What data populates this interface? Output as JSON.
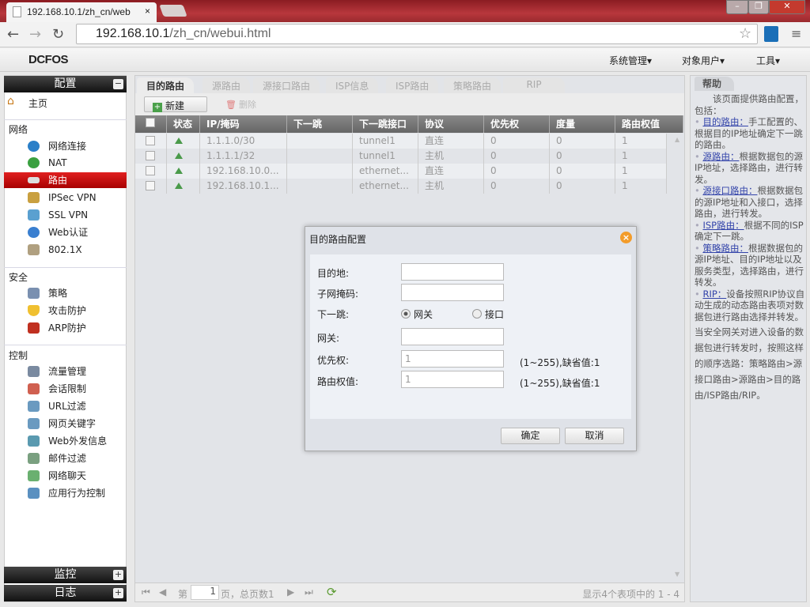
{
  "browser": {
    "tab_title": "192.168.10.1/zh_cn/web",
    "tab_close": "×",
    "url_host": "192.168.10.1",
    "url_path": "/zh_cn/webui.html"
  },
  "app": {
    "logo": "DCFOS",
    "menus": [
      "系统管理▾",
      "对象用户▾",
      "工具▾"
    ]
  },
  "sidebar": {
    "config_header": "配置",
    "home": "主页",
    "groups": [
      {
        "label": "网络",
        "items": [
          "网络连接",
          "NAT",
          "路由",
          "IPSec VPN",
          "SSL VPN",
          "Web认证",
          "802.1X"
        ]
      },
      {
        "label": "安全",
        "items": [
          "策略",
          "攻击防护",
          "ARP防护"
        ]
      },
      {
        "label": "控制",
        "items": [
          "流量管理",
          "会话限制",
          "URL过滤",
          "网页关键字",
          "Web外发信息",
          "邮件过滤",
          "网络聊天",
          "应用行为控制"
        ]
      }
    ],
    "monitor_header": "监控",
    "log_header": "日志",
    "selected": "路由"
  },
  "tabs": [
    "目的路由",
    "源路由",
    "源接口路由",
    "ISP信息",
    "ISP路由",
    "策略路由",
    "RIP"
  ],
  "toolbar": {
    "new": "新建",
    "delete": "删除"
  },
  "table": {
    "headers": [
      "状态",
      "IP/掩码",
      "下一跳",
      "下一跳接口",
      "协议",
      "优先权",
      "度量",
      "路由权值"
    ],
    "rows": [
      [
        "1.1.1.0/30",
        "",
        "tunnel1",
        "直连",
        "0",
        "0",
        "1"
      ],
      [
        "1.1.1.1/32",
        "",
        "tunnel1",
        "主机",
        "0",
        "0",
        "1"
      ],
      [
        "192.168.10.0...",
        "",
        "ethernet...",
        "直连",
        "0",
        "0",
        "1"
      ],
      [
        "192.168.10.1...",
        "",
        "ethernet...",
        "主机",
        "0",
        "0",
        "1"
      ]
    ]
  },
  "pager": {
    "page_prefix": "第",
    "page": "1",
    "page_suffix": "页，总页数1",
    "summary": "显示4个表项中的 1 - 4"
  },
  "help": {
    "title": "帮助",
    "intro": "该页面提供路由配置，包括：",
    "items": [
      {
        "link": "目的路由：",
        "text": "手工配置的、根据目的IP地址确定下一跳的路由。"
      },
      {
        "link": "源路由：",
        "text": "根据数据包的源IP地址，选择路由，进行转发。"
      },
      {
        "link": "源接口路由：",
        "text": "根据数据包的源IP地址和入接口，选择路由，进行转发。"
      },
      {
        "link": "ISP路由：",
        "text": "根据不同的ISP确定下一跳。"
      },
      {
        "link": "策略路由：",
        "text": "根据数据包的源IP地址、目的IP地址以及服务类型，选择路由，进行转发。"
      },
      {
        "link": "RIP：",
        "text": "设备按照RIP协议自动生成的动态路由表项对数据包进行路由选择并转发。"
      }
    ],
    "footer": "当安全网关对进入设备的数据包进行转发时，按照这样的顺序选路：策略路由>源接口路由>源路由>目的路由/ISP路由/RIP。"
  },
  "dialog": {
    "title": "目的路由配置",
    "dest_label": "目的地:",
    "mask_label": "子网掩码:",
    "nexthop_label": "下一跳:",
    "radio_gateway": "网关",
    "radio_interface": "接口",
    "gateway_label": "网关:",
    "priority_label": "优先权:",
    "priority_value": "1",
    "priority_hint": "(1~255),缺省值:1",
    "weight_label": "路由权值:",
    "weight_value": "1",
    "weight_hint": "(1~255),缺省值:1",
    "ok": "确定",
    "cancel": "取消"
  }
}
